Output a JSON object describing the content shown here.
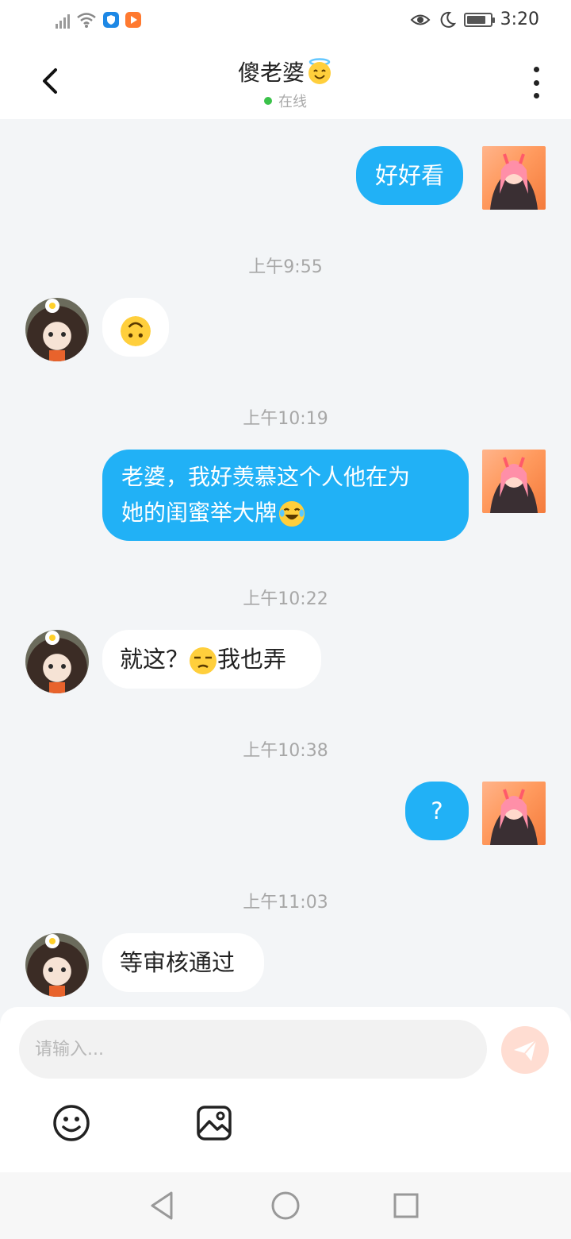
{
  "status_bar": {
    "time": "3:20",
    "battery_level": 0.85
  },
  "header": {
    "title": "傻老婆",
    "status": "在线"
  },
  "messages": [
    {
      "dir": "out",
      "type": "text",
      "text": "好好看"
    },
    {
      "dir": "in",
      "type": "timestamp",
      "text": "上午9:55"
    },
    {
      "dir": "in",
      "type": "emoji",
      "emoji": "upside-down-face"
    },
    {
      "dir": "in",
      "type": "timestamp",
      "text": "上午10:19"
    },
    {
      "dir": "out",
      "type": "text",
      "line1": "老婆，我好羡慕这个人他在为",
      "line2": "她的闺蜜举大牌",
      "emoji": "tears-of-joy"
    },
    {
      "dir": "in",
      "type": "timestamp",
      "text": "上午10:22"
    },
    {
      "dir": "in",
      "type": "text",
      "text_before": "就这？",
      "emoji": "unamused-face",
      "text_after": "我也弄"
    },
    {
      "dir": "in",
      "type": "timestamp",
      "text": "上午10:38"
    },
    {
      "dir": "out",
      "type": "text",
      "text": "?"
    },
    {
      "dir": "in",
      "type": "timestamp",
      "text": "上午11:03"
    },
    {
      "dir": "in",
      "type": "text",
      "text": "等审核通过"
    }
  ],
  "composer": {
    "placeholder": "请输入...",
    "value": ""
  },
  "colors": {
    "outgoing_bubble": "#21b1f6",
    "incoming_bubble": "#ffffff",
    "online_dot": "#3bc24a",
    "send_button": "#ffddd2"
  }
}
